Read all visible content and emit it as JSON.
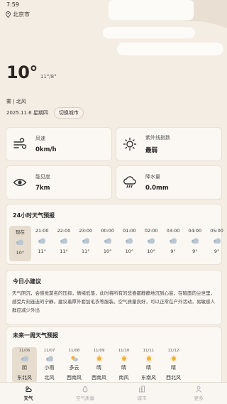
{
  "status_bar": {
    "time": "7:59"
  },
  "location": {
    "city": "北京市"
  },
  "current": {
    "temperature": "10°",
    "range": "11°/8°",
    "description": "雾 | 北风",
    "date": "2025.11.6 星期四",
    "switch_city_label": "切换城市"
  },
  "metrics": [
    {
      "label": "风速",
      "value": "0km/h",
      "icon": "wind-icon"
    },
    {
      "label": "紫外线指数",
      "value": "最弱",
      "icon": "sun-icon"
    },
    {
      "label": "能见度",
      "value": "7km",
      "icon": "eye-icon"
    },
    {
      "label": "降水量",
      "value": "0.0mm",
      "icon": "rain-cloud-icon"
    }
  ],
  "hourly": {
    "title": "24小时天气预报",
    "items": [
      {
        "time": "现在",
        "temp": "10°"
      },
      {
        "time": "21:00",
        "temp": "11°"
      },
      {
        "time": "22:00",
        "temp": "11°"
      },
      {
        "time": "23:00",
        "temp": "11°"
      },
      {
        "time": "00:00",
        "temp": "10°"
      },
      {
        "time": "01:00",
        "temp": "10°"
      },
      {
        "time": "02:00",
        "temp": "10°"
      },
      {
        "time": "03:00",
        "temp": "9°"
      },
      {
        "time": "04:00",
        "temp": "9°"
      },
      {
        "time": "05:00",
        "temp": "9°"
      }
    ]
  },
  "tip": {
    "title": "今日小建议",
    "body": "天气阴沉，会感觉莫名的压抑，情绪低落，此时将所有的悲喜都静静地沉到心底，在暗面的尘世里，感受片刻连连的宁静。建议着厚外套加毛衣等服装。空气质量良好，可以正常在户外活动，易敏感人群应减少外出"
  },
  "weekly": {
    "title": "未来一周天气预报",
    "items": [
      {
        "date": "11/06",
        "condition": "阴",
        "wind": "东北风"
      },
      {
        "date": "11/07",
        "condition": "小雨",
        "wind": "北风"
      },
      {
        "date": "11/08",
        "condition": "多云",
        "wind": "西南风"
      },
      {
        "date": "11/09",
        "condition": "晴",
        "wind": "西南风"
      },
      {
        "date": "11/10",
        "condition": "晴",
        "wind": "南风"
      },
      {
        "date": "11/11",
        "condition": "晴",
        "wind": "东南风"
      },
      {
        "date": "11/12",
        "condition": "晴",
        "wind": "西北风"
      }
    ]
  },
  "nav": [
    {
      "label": "天气",
      "icon": "weather-icon",
      "active": true
    },
    {
      "label": "空气质量",
      "icon": "air-quality-icon",
      "active": false
    },
    {
      "label": "城市",
      "icon": "city-icon",
      "active": false
    },
    {
      "label": "更多",
      "icon": "user-icon",
      "active": false
    }
  ],
  "colors": {
    "background": "#f4ede3",
    "card": "#fbf8f3",
    "highlight": "#e7ddce",
    "sun": "#f2b233"
  }
}
